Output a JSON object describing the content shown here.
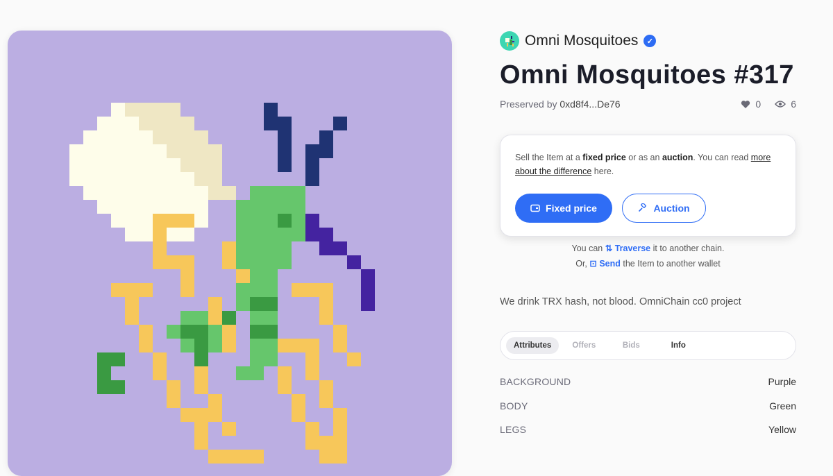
{
  "collection": {
    "name": "Omni Mosquitoes",
    "verified": true
  },
  "item": {
    "title": "Omni Mosquitoes #317"
  },
  "meta": {
    "preserved_label": "Preserved by",
    "owner": "0xd8f4...De76",
    "likes": "0",
    "views": "6"
  },
  "sell": {
    "text_1": "Sell the Item at a ",
    "fixed_bold": "fixed price",
    "text_2": " or as an ",
    "auction_bold": "auction",
    "text_3": ". You can read ",
    "link": "more about the difference",
    "text_4": " here.",
    "fixed_btn": "Fixed price",
    "auction_btn": "Auction"
  },
  "transfer": {
    "line1_pre": "You can ",
    "traverse": "Traverse",
    "line1_post": " it to another chain.",
    "line2_pre": "Or, ",
    "send": "Send",
    "line2_post": " the Item to another wallet"
  },
  "description": "We drink TRX hash, not blood. OmniChain cc0 project",
  "tabs": [
    "Attributes",
    "Offers",
    "Bids",
    "Info"
  ],
  "attributes": [
    {
      "key": "BACKGROUND",
      "value": "Purple"
    },
    {
      "key": "BODY",
      "value": "Green"
    },
    {
      "key": "LEGS",
      "value": "Yellow"
    }
  ],
  "colors": {
    "accent": "#2f6df5",
    "art_bg": "#bbaee2",
    "wing": "#fefdea",
    "wing_shade": "#efe7c4",
    "body": "#66c66c",
    "body_dark": "#3a9a42",
    "legs": "#f7c75a",
    "antenna": "#1f3373",
    "proboscis": "#4423a0"
  }
}
